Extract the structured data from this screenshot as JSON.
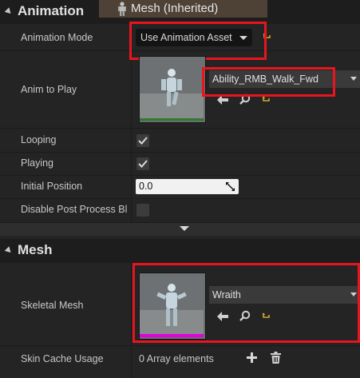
{
  "animation_section": {
    "title": "Animation",
    "mesh_tab_label": "Mesh (Inherited)",
    "rows": {
      "animation_mode": {
        "label": "Animation Mode",
        "value": "Use Animation Asset"
      },
      "anim_to_play": {
        "label": "Anim to Play",
        "asset": "Ability_RMB_Walk_Fwd"
      },
      "looping": {
        "label": "Looping",
        "checked": true
      },
      "playing": {
        "label": "Playing",
        "checked": true
      },
      "initial_position": {
        "label": "Initial Position",
        "value": "0.0"
      },
      "disable_post_process": {
        "label": "Disable Post Process Bl",
        "checked": false
      }
    }
  },
  "mesh_section": {
    "title": "Mesh",
    "rows": {
      "skeletal_mesh": {
        "label": "Skeletal Mesh",
        "asset": "Wraith"
      },
      "skin_cache_usage": {
        "label": "Skin Cache Usage",
        "value": "0 Array elements"
      }
    }
  },
  "icons": {
    "use_selected": "left-arrow-icon",
    "browse": "magnifier-icon",
    "reset": "reset-arrow-icon",
    "add": "plus-icon",
    "delete": "trash-icon",
    "section_collapse": "triangle-down-icon",
    "advanced": "chevron-down-icon"
  },
  "colors": {
    "highlight": "#e8141e",
    "reset_yellow": "#d6a62a",
    "anim_thumb_bar": "#2f7a2f",
    "mesh_thumb_bar": "#e000e0"
  }
}
